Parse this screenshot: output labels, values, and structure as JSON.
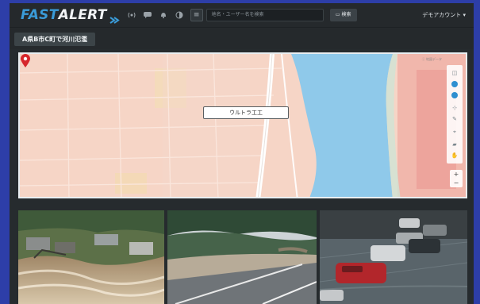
{
  "app": {
    "logo_fast": "FAST",
    "logo_alert": "ALERT",
    "search_placeholder": "地名・ユーザー名を検索",
    "search_button": "検索",
    "account_label": "デモアカウント"
  },
  "header_icons": [
    "broadcast-icon",
    "chat-icon",
    "bell-icon",
    "contrast-icon",
    "menu-icon"
  ],
  "page": {
    "title": "A県B市C町で河川氾濫"
  },
  "map": {
    "tooltip": "ウルトラ工工",
    "attribution": "ⓘ 地図データ",
    "zoom_in": "+",
    "zoom_out": "−",
    "tools": [
      "layers-icon",
      "location-icon",
      "ruler-icon",
      "settings-icon",
      "draw-icon",
      "pin-icon",
      "car-icon",
      "hand-icon"
    ]
  },
  "photos": [
    {
      "name": "flooded-village-photo"
    },
    {
      "name": "flooded-road-photo"
    },
    {
      "name": "flooded-parking-photo"
    }
  ],
  "colors": {
    "accent": "#3a9bd8",
    "background": "#2d3ea8",
    "panel": "#262b2e",
    "river": "#8fc9ea",
    "map_land": "#f6d5c6",
    "pin": "#d6262b"
  }
}
